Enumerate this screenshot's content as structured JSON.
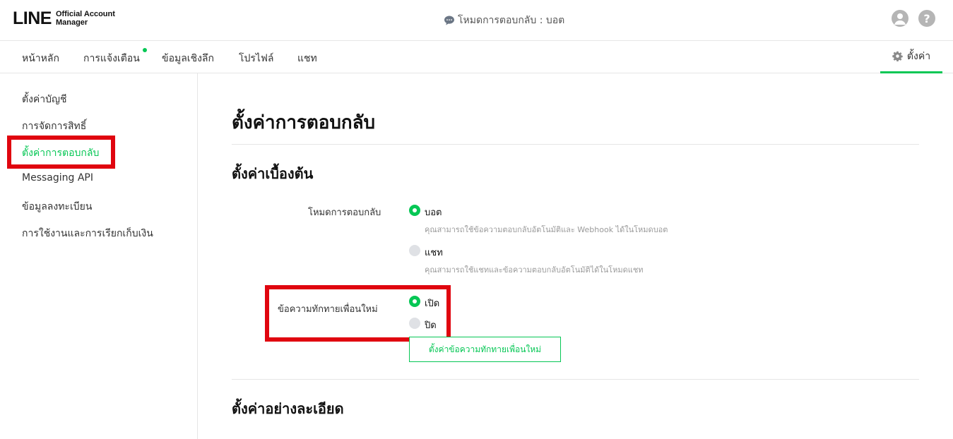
{
  "app": {
    "logo_main": "LINE",
    "logo_sub_line1": "Official Account",
    "logo_sub_line2": "Manager",
    "mode_indicator": "โหมดการตอบกลับ : บอต"
  },
  "top_icons": [
    {
      "icon": "user-icon"
    },
    {
      "icon": "help-icon",
      "glyph": "?"
    }
  ],
  "nav": {
    "items": [
      {
        "label": "หน้าหลัก"
      },
      {
        "label": "การแจ้งเตือน",
        "has_dot": true
      },
      {
        "label": "ข้อมูลเชิงลึก"
      },
      {
        "label": "โปรไฟล์"
      },
      {
        "label": "แชท"
      }
    ],
    "settings_label": "ตั้งค่า"
  },
  "sidebar": {
    "items": [
      {
        "label": "ตั้งค่าบัญชี"
      },
      {
        "label": "การจัดการสิทธิ์"
      },
      {
        "label": "ตั้งค่าการตอบกลับ",
        "active": true
      },
      {
        "label": "Messaging API"
      },
      {
        "label": "ข้อมูลลงทะเบียน"
      },
      {
        "label": "การใช้งานและการเรียกเก็บเงิน"
      }
    ]
  },
  "main": {
    "title": "ตั้งค่าการตอบกลับ",
    "basic_section": {
      "title": "ตั้งค่าเบื้องต้น",
      "reply_mode": {
        "label": "โหมดการตอบกลับ",
        "options": [
          {
            "label": "บอต",
            "selected": true,
            "description": "คุณสามารถใช้ข้อความตอบกลับอัตโนมัติและ Webhook ได้ในโหมดบอต"
          },
          {
            "label": "แชท",
            "selected": false,
            "description": "คุณสามารถใช้แชทและข้อความตอบกลับอัตโนมัติได้ในโหมดแชท"
          }
        ]
      },
      "greeting": {
        "label": "ข้อความทักทายเพื่อนใหม่",
        "options": [
          {
            "label": "เปิด",
            "selected": true
          },
          {
            "label": "ปิด",
            "selected": false
          }
        ],
        "button_label": "ตั้งค่าข้อความทักทายเพื่อนใหม่"
      }
    },
    "advanced_section": {
      "title": "ตั้งค่าอย่างละเอียด"
    }
  },
  "colors": {
    "accent": "#06c755",
    "highlight": "#e0050f",
    "radio_off": "#dfe1e5"
  }
}
